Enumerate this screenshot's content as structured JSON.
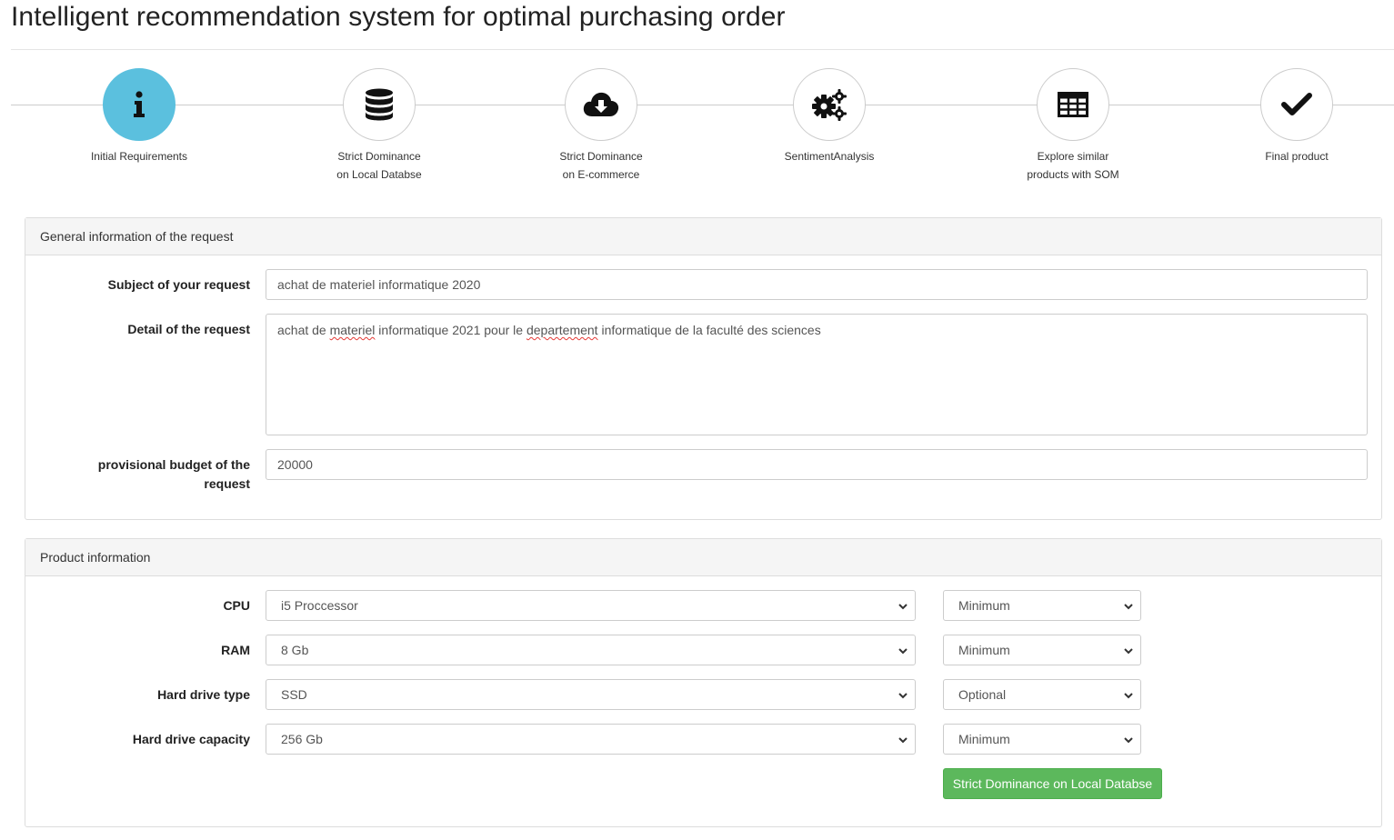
{
  "page": {
    "title": "Intelligent recommendation system for optimal purchasing order"
  },
  "wizard": {
    "active_color": "#5bc0de",
    "steps": [
      {
        "line1": "Initial Requirements",
        "line2": "",
        "icon": "info-icon"
      },
      {
        "line1": "Strict Dominance",
        "line2": "on Local Databse",
        "icon": "database-icon"
      },
      {
        "line1": "Strict Dominance",
        "line2": "on E-commerce",
        "icon": "cloud-download-icon"
      },
      {
        "line1": "SentimentAnalysis",
        "line2": "",
        "icon": "gears-icon"
      },
      {
        "line1": "Explore similar",
        "line2": "products with SOM",
        "icon": "table-icon"
      },
      {
        "line1": "Final product",
        "line2": "",
        "icon": "check-icon"
      }
    ]
  },
  "general": {
    "heading": "General information of the request",
    "subject_label": "Subject of your request",
    "subject_value": "achat de materiel informatique 2020",
    "detail_label": "Detail of the request",
    "detail_value": {
      "p1": "achat de ",
      "w1": "materiel",
      "p2": " informatique 2021 pour le ",
      "w2": "departement",
      "p3": " informatique de la faculté des sciences"
    },
    "budget_label_line1": "provisional budget of the",
    "budget_label_line2": "request",
    "budget_value": "20000"
  },
  "product": {
    "heading": "Product information",
    "rows": [
      {
        "label": "CPU",
        "value": "i5 Proccessor",
        "level": "Minimum"
      },
      {
        "label": "RAM",
        "value": "8 Gb",
        "level": "Minimum"
      },
      {
        "label": "Hard drive type",
        "value": "SSD",
        "level": "Optional"
      },
      {
        "label": "Hard drive capacity",
        "value": "256 Gb",
        "level": "Minimum"
      }
    ],
    "submit_label": "Strict Dominance on Local Databse",
    "submit_color": "#5cb85c"
  }
}
